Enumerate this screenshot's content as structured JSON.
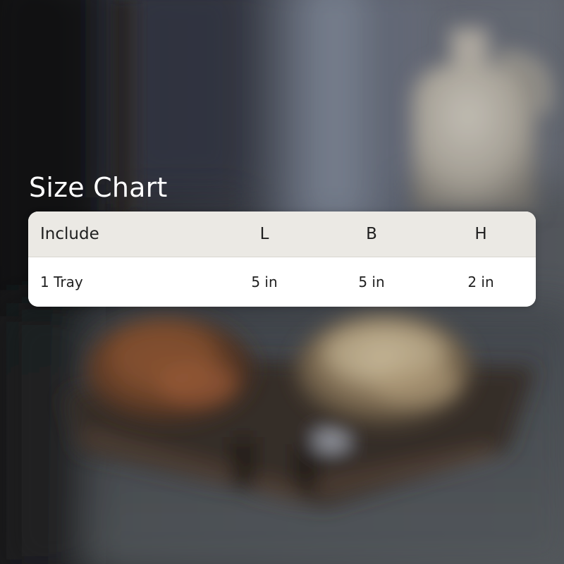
{
  "title": "Size Chart",
  "table": {
    "headers": [
      "Include",
      "L",
      "B",
      "H"
    ],
    "rows": [
      [
        "1 Tray",
        "5 in",
        "5 in",
        "2 in"
      ]
    ]
  },
  "colors": {
    "title_text": "#ffffff",
    "header_background": "#ebe9e4",
    "row_background": "#ffffff",
    "cell_text": "#1f1f1f"
  },
  "background_icons": [
    "vase-photo",
    "tray-photo",
    "bowl-photo"
  ]
}
